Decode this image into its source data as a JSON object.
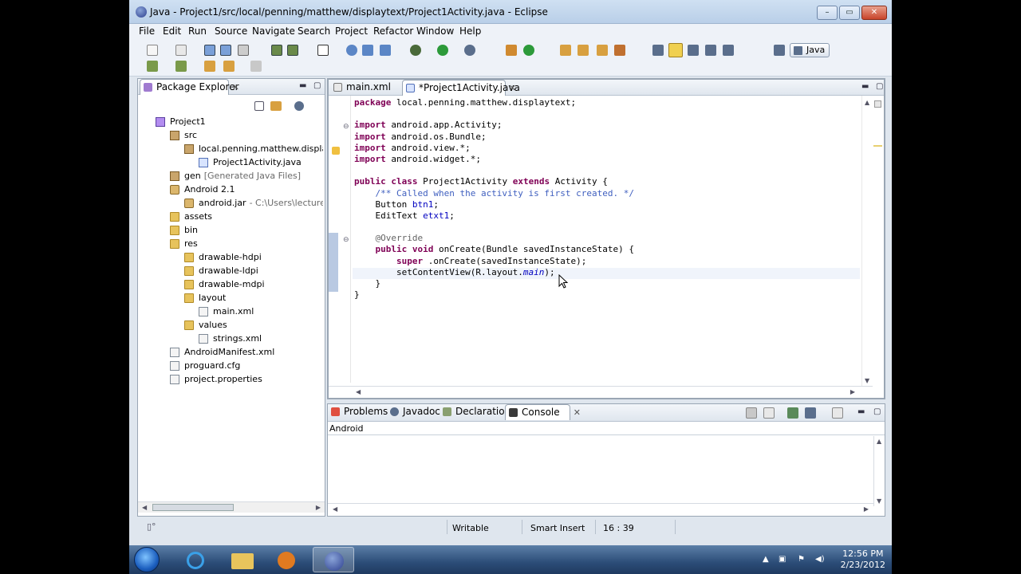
{
  "window": {
    "title": "Java - Project1/src/local/penning/matthew/displaytext/Project1Activity.java - Eclipse",
    "minimize": "–",
    "maximize": "▭",
    "close": "✕"
  },
  "menu": [
    "File",
    "Edit",
    "Run",
    "Source",
    "Navigate",
    "Search",
    "Project",
    "Refactor",
    "Window",
    "Help"
  ],
  "perspective": "Java",
  "package_explorer": {
    "title": "Package Explorer",
    "tree": [
      {
        "label": "Project1",
        "icon": "project-icon"
      },
      {
        "label": "src",
        "icon": "source-folder-icon"
      },
      {
        "label": "local.penning.matthew.display",
        "icon": "package-icon"
      },
      {
        "label": "Project1Activity.java",
        "icon": "java-file-icon"
      },
      {
        "label": "gen",
        "extra": "[Generated Java Files]",
        "icon": "source-folder-icon"
      },
      {
        "label": "Android 2.1",
        "icon": "library-icon"
      },
      {
        "label": "android.jar",
        "extra": "- C:\\Users\\lecturesr",
        "icon": "jar-icon"
      },
      {
        "label": "assets",
        "icon": "folder-icon"
      },
      {
        "label": "bin",
        "icon": "folder-icon"
      },
      {
        "label": "res",
        "icon": "folder-icon"
      },
      {
        "label": "drawable-hdpi",
        "icon": "folder-icon"
      },
      {
        "label": "drawable-ldpi",
        "icon": "folder-icon"
      },
      {
        "label": "drawable-mdpi",
        "icon": "folder-icon"
      },
      {
        "label": "layout",
        "icon": "folder-icon"
      },
      {
        "label": "main.xml",
        "icon": "xml-file-icon"
      },
      {
        "label": "values",
        "icon": "folder-icon"
      },
      {
        "label": "strings.xml",
        "icon": "xml-file-icon"
      },
      {
        "label": "AndroidManifest.xml",
        "icon": "xml-file-icon"
      },
      {
        "label": "proguard.cfg",
        "icon": "file-icon"
      },
      {
        "label": "project.properties",
        "icon": "file-icon"
      }
    ]
  },
  "editor": {
    "tabs": [
      "main.xml",
      "*Project1Activity.java"
    ],
    "code": [
      {
        "t": [
          [
            "kw",
            "package"
          ],
          [
            "",
            "local.penning.matthew.displaytext;"
          ]
        ]
      },
      {
        "t": []
      },
      {
        "t": [
          [
            "kw",
            "import"
          ],
          [
            "",
            "android.app.Activity;"
          ]
        ]
      },
      {
        "t": [
          [
            "kw",
            "import"
          ],
          [
            "",
            "android.os.Bundle;"
          ]
        ]
      },
      {
        "t": [
          [
            "kw",
            "import"
          ],
          [
            "",
            "android.view.*;"
          ]
        ]
      },
      {
        "t": [
          [
            "kw",
            "import"
          ],
          [
            "",
            "android.widget.*;"
          ]
        ]
      },
      {
        "t": []
      },
      {
        "t": [
          [
            "kw",
            "public class"
          ],
          [
            "",
            "Project1Activity"
          ],
          [
            "kw",
            "extends"
          ],
          [
            "",
            "Activity {"
          ]
        ]
      },
      {
        "t": [
          [
            "cm",
            "    /** Called when the activity is first created. */"
          ]
        ]
      },
      {
        "t": [
          [
            "",
            "    Button "
          ],
          [
            "var",
            "btn1"
          ],
          [
            "",
            ";"
          ]
        ]
      },
      {
        "t": [
          [
            "",
            "    EditText "
          ],
          [
            "var",
            "etxt1"
          ],
          [
            "",
            ";"
          ]
        ]
      },
      {
        "t": []
      },
      {
        "t": [
          [
            "an",
            "    @Override"
          ]
        ]
      },
      {
        "t": [
          [
            "kw",
            "    public void"
          ],
          [
            "",
            "onCreate(Bundle savedInstanceState) {"
          ]
        ]
      },
      {
        "t": [
          [
            "kw",
            "        super"
          ],
          [
            "",
            ".onCreate(savedInstanceState);"
          ]
        ]
      },
      {
        "t": [
          [
            "",
            "        setContentView(R.layout."
          ],
          [
            "it",
            "main"
          ],
          [
            "",
            ");"
          ]
        ]
      },
      {
        "t": [
          [
            "",
            "    }"
          ]
        ]
      },
      {
        "t": [
          [
            "",
            "}"
          ]
        ]
      }
    ]
  },
  "bottom_panel": {
    "tabs": [
      "Problems",
      "Javadoc",
      "Declaration",
      "Console"
    ],
    "console_name": "Android"
  },
  "status": {
    "writable": "Writable",
    "insert_mode": "Smart Insert",
    "position": "16 : 39"
  },
  "taskbar": {
    "time": "12:56 PM",
    "date": "2/23/2012"
  }
}
